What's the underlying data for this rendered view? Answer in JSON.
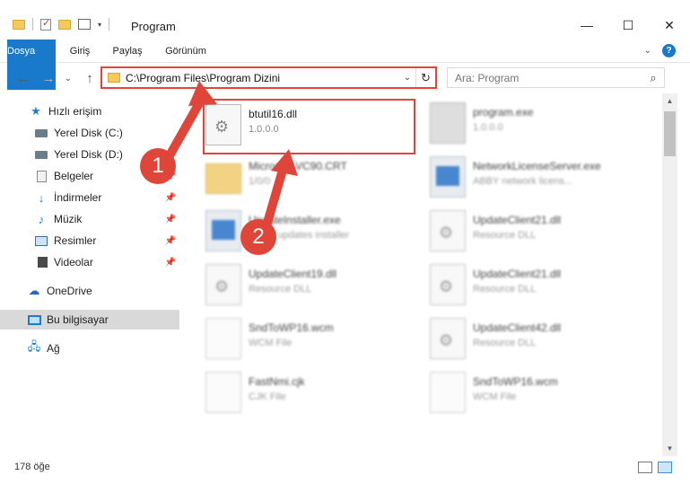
{
  "window": {
    "title": "Program",
    "minimize": "—",
    "maximize": "☐",
    "close": "✕"
  },
  "ribbon": {
    "tabs": [
      "Dosya",
      "Giriş",
      "Paylaş",
      "Görünüm"
    ],
    "help": "?",
    "collapse": "⌄"
  },
  "nav": {
    "back": "←",
    "forward": "→",
    "recent": "⌄",
    "up": "↑",
    "address": "C:\\Program Files\\Program Dizini",
    "address_dropdown": "⌄",
    "refresh": "↻",
    "search_placeholder": "Ara: Program",
    "search_icon": "⌕"
  },
  "sidebar": {
    "items": [
      {
        "label": "Hızlı erişim",
        "icon": "star-icon"
      },
      {
        "label": "Yerel Disk (C:)",
        "icon": "drive-icon"
      },
      {
        "label": "Yerel Disk (D:)",
        "icon": "drive-icon"
      },
      {
        "label": "Belgeler",
        "icon": "documents-icon"
      },
      {
        "label": "İndirmeler",
        "icon": "download-icon"
      },
      {
        "label": "Müzik",
        "icon": "music-icon"
      },
      {
        "label": "Resimler",
        "icon": "pictures-icon"
      },
      {
        "label": "Videolar",
        "icon": "videos-icon"
      },
      {
        "label": "OneDrive",
        "icon": "cloud-icon"
      },
      {
        "label": "Bu bilgisayar",
        "icon": "computer-icon"
      },
      {
        "label": "Ağ",
        "icon": "network-icon"
      }
    ],
    "selected": "Bu bilgisayar"
  },
  "files": [
    {
      "name": "btutil16.dll",
      "sub": "1.0.0.0",
      "type": "dll"
    },
    {
      "name": "program.exe",
      "sub": "1.0.0.0",
      "type": "exe"
    },
    {
      "name": "Microsoft.VC90.CRT",
      "sub": "1/0/0",
      "type": "folder"
    },
    {
      "name": "NetworkLicenseServer.exe",
      "sub": "ABBY network licens...",
      "type": "app"
    },
    {
      "name": "UpdateInstaller.exe",
      "sub": "ABBY updates installer",
      "type": "app"
    },
    {
      "name": "UpdateClient21.dll",
      "sub": "Resource DLL",
      "type": "dll"
    },
    {
      "name": "UpdateClient19.dll",
      "sub": "Resource DLL",
      "type": "dll"
    },
    {
      "name": "UpdateClient21.dll",
      "sub": "Resource DLL",
      "type": "dll"
    },
    {
      "name": "SndToWP16.wcm",
      "sub": "WCM File",
      "type": "blank"
    },
    {
      "name": "UpdateClient42.dll",
      "sub": "Resource DLL",
      "type": "dll"
    },
    {
      "name": "FastNmi.cjk",
      "sub": "CJK File",
      "type": "blank"
    },
    {
      "name": "SndToWP16.wcm",
      "sub": "WCM File",
      "type": "blank"
    }
  ],
  "annotations": [
    "1",
    "2"
  ],
  "status": {
    "count": "178 öğe"
  },
  "colors": {
    "accent": "#1979ca",
    "highlight": "#e0453a"
  }
}
